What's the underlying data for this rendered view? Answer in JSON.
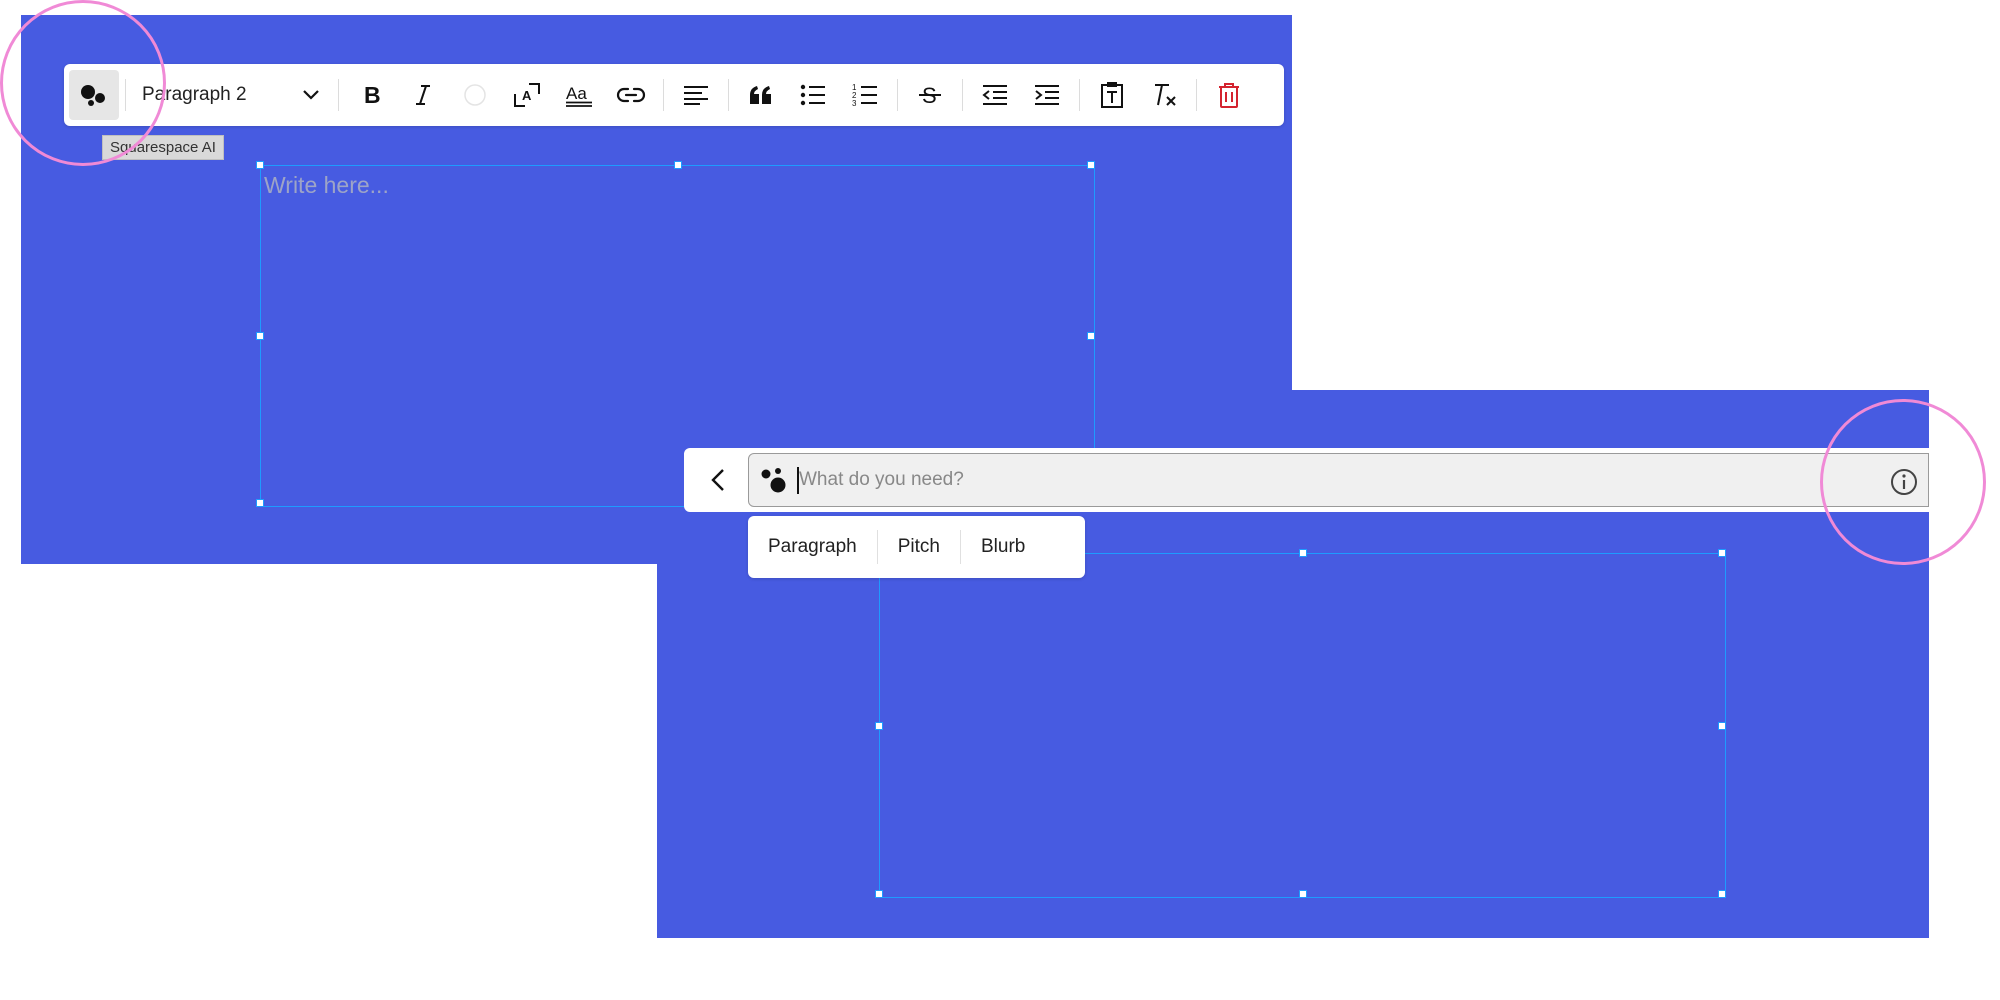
{
  "toolbar": {
    "paragraph_style": "Paragraph 2",
    "buttons": [
      "squarespace-ai",
      "bold",
      "italic",
      "text-color",
      "text-size",
      "font",
      "link",
      "align-left",
      "quote",
      "bulleted-list",
      "numbered-list",
      "strikethrough",
      "outdent",
      "indent",
      "paste-as-text",
      "clear-formatting",
      "delete"
    ]
  },
  "tooltip": {
    "text": "Squarespace AI"
  },
  "editor": {
    "placeholder": "Write here..."
  },
  "ai_prompt": {
    "placeholder": "What do you need?"
  },
  "suggestions": [
    "Paragraph",
    "Pitch",
    "Blurb"
  ],
  "colors": {
    "canvas": "#475be1",
    "selection": "#1e9bff",
    "highlight_ring": "#f08ad6",
    "delete": "#d4232f"
  }
}
